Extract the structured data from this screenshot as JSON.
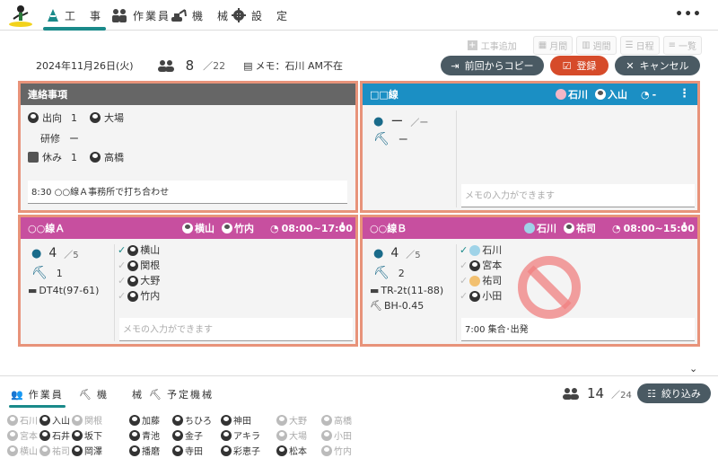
{
  "nav": {
    "tabs": [
      {
        "label": "工　事"
      },
      {
        "label": "作業員"
      },
      {
        "label": "機　械"
      },
      {
        "label": "設　定"
      }
    ]
  },
  "tools": {
    "add_work": "工事追加",
    "month": "月間",
    "week": "週間",
    "day": "日程",
    "list": "一覧"
  },
  "info": {
    "date": "2024年11月26日(火)",
    "count": "8",
    "total": "／22",
    "memo": "メモ：石川 AM不在"
  },
  "actions": {
    "copy": "前回からコピー",
    "register": "登録",
    "cancel": "キャンセル"
  },
  "colors": {
    "notice": "#666666",
    "blue": "#1b8fc4",
    "magenta": "#c74f9f",
    "accent": "#d64b2a",
    "panel_border": "#e8937a",
    "teal": "#1a8a8a"
  },
  "notice": {
    "title": "連絡事項",
    "rows": [
      {
        "label": "出向",
        "count": "1",
        "name": "大場"
      },
      {
        "label": "研修",
        "count": "ー",
        "name": ""
      },
      {
        "label": "休み",
        "count": "1",
        "name": "高橋"
      }
    ],
    "memo": "8:30 ○○線Ａ事務所で打ち合わせ"
  },
  "p2": {
    "title": "□□線",
    "leaders": [
      "石川",
      "入山"
    ],
    "time": "-",
    "count": "ー",
    "total": "／ー",
    "machine": "ー",
    "memo": "メモの入力ができます"
  },
  "p3": {
    "title": "○○線Ａ",
    "leaders": [
      "横山",
      "竹内"
    ],
    "time": "08:00~17:00",
    "count": "4",
    "total": "／5",
    "machines": "1",
    "equipment": [
      "DT4t(97-61)"
    ],
    "workers": [
      "横山",
      "関根",
      "大野",
      "竹内"
    ],
    "memo": "メモの入力ができます"
  },
  "p4": {
    "title": "○○線Ｂ",
    "leaders": [
      "石川",
      "祐司"
    ],
    "time": "08:00~15:00",
    "count": "4",
    "total": "／5",
    "machines": "2",
    "equipment": [
      "TR-2t(11-88)",
      "BH-0.45"
    ],
    "workers": [
      "石川",
      "宮本",
      "祐司",
      "小田"
    ],
    "memo": "7:00 集合･出発"
  },
  "bottom": {
    "tabs": [
      "作業員",
      "機　　械",
      "予定機械"
    ],
    "count": "14",
    "total": "／24",
    "filter": "絞り込み",
    "workers": [
      {
        "name": "石川",
        "off": true
      },
      {
        "name": "入山",
        "off": false
      },
      {
        "name": "関根",
        "off": true
      },
      {
        "name": "加藤",
        "off": false
      },
      {
        "name": "ちひろ",
        "off": false
      },
      {
        "name": "神田",
        "off": false
      },
      {
        "name": "大野",
        "off": true
      },
      {
        "name": "高橋",
        "off": true
      },
      {
        "name": "宮本",
        "off": true
      },
      {
        "name": "石井",
        "off": false
      },
      {
        "name": "坂下",
        "off": false
      },
      {
        "name": "青池",
        "off": false
      },
      {
        "name": "金子",
        "off": false
      },
      {
        "name": "アキラ",
        "off": false
      },
      {
        "name": "大場",
        "off": true
      },
      {
        "name": "小田",
        "off": true
      },
      {
        "name": "横山",
        "off": true
      },
      {
        "name": "祐司",
        "off": true
      },
      {
        "name": "岡澤",
        "off": false
      },
      {
        "name": "播磨",
        "off": false
      },
      {
        "name": "寺田",
        "off": false
      },
      {
        "name": "彩恵子",
        "off": false
      },
      {
        "name": "松本",
        "off": false
      },
      {
        "name": "竹内",
        "off": true
      }
    ]
  }
}
